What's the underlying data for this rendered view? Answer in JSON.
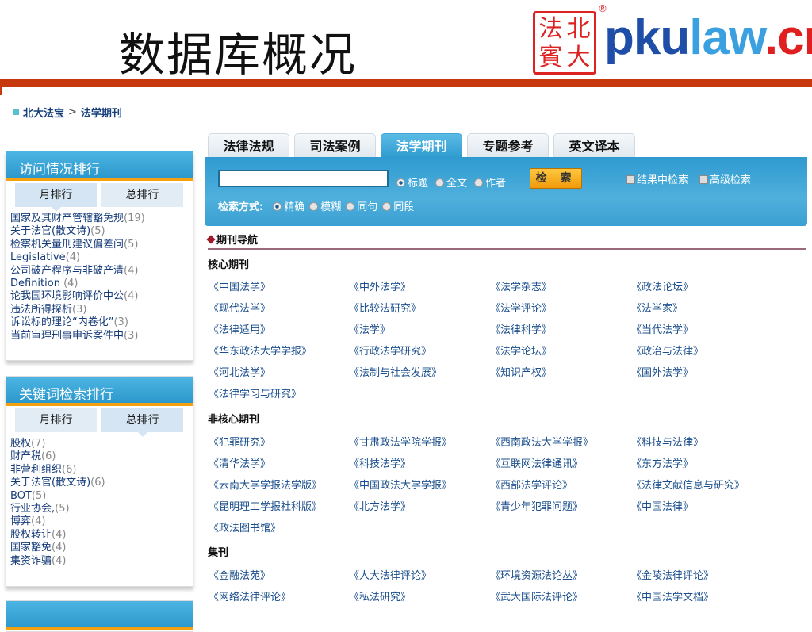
{
  "slide_title": "数据库概况",
  "logo": {
    "seal_chars": [
      "法",
      "北",
      "賓",
      "大"
    ],
    "text_parts": [
      "pku",
      "law",
      ".cn"
    ],
    "reg": "®"
  },
  "breadcrumb": {
    "home": "北大法宝",
    "sep": ">",
    "current": "法学期刊"
  },
  "visit_panel": {
    "title": "访问情况排行",
    "tabs": [
      "月排行",
      "总排行"
    ],
    "active_tab": 0,
    "items": [
      {
        "t": "国家及其财产管辖豁免规",
        "c": "(19)"
      },
      {
        "t": "关于法官(散文诗)",
        "c": "(5)"
      },
      {
        "t": "检察机关量刑建议偏差问",
        "c": "(5)"
      },
      {
        "t": "Legislative",
        "c": "(4)"
      },
      {
        "t": "公司破产程序与非破产清",
        "c": "(4)"
      },
      {
        "t": "Definition ",
        "c": "(4)"
      },
      {
        "t": "论我国环境影响评价中公",
        "c": "(4)"
      },
      {
        "t": "违法所得探析",
        "c": "(3)"
      },
      {
        "t": "诉讼标的理论“内卷化”",
        "c": "(3)"
      },
      {
        "t": "当前审理刑事申诉案件中",
        "c": "(3)"
      }
    ]
  },
  "keyword_panel": {
    "title": "关键词检索排行",
    "tabs": [
      "月排行",
      "总排行"
    ],
    "active_tab": 1,
    "items": [
      {
        "t": "股权",
        "c": "(7)"
      },
      {
        "t": "财产税",
        "c": "(6)"
      },
      {
        "t": "非营利组织",
        "c": "(6)"
      },
      {
        "t": "关于法官(散文诗)",
        "c": "(6)"
      },
      {
        "t": "BOT",
        "c": "(5)"
      },
      {
        "t": "行业协会,",
        "c": "(5)"
      },
      {
        "t": "博弈",
        "c": "(4)"
      },
      {
        "t": "股权转让",
        "c": "(4)"
      },
      {
        "t": "国家豁免",
        "c": "(4)"
      },
      {
        "t": "集资诈骗",
        "c": "(4)"
      }
    ]
  },
  "main_tabs": [
    "法律法规",
    "司法案例",
    "法学期刊",
    "专题参考",
    "英文译本"
  ],
  "active_main_tab": 2,
  "search": {
    "input_value": "",
    "scope_options": [
      "标题",
      "全文",
      "作者"
    ],
    "scope_selected": 0,
    "button": "检 索",
    "checkboxes": [
      "结果中检索",
      "高级检索"
    ],
    "mode_label": "检索方式:",
    "mode_options": [
      "精确",
      "模糊",
      "同句",
      "同段"
    ],
    "mode_selected": 0
  },
  "nav_title": "期刊导航",
  "sections": [
    {
      "title": "核心期刊",
      "items": [
        "《中国法学》",
        "《中外法学》",
        "《法学杂志》",
        "《政法论坛》",
        "《现代法学》",
        "《比较法研究》",
        "《法学评论》",
        "《法学家》",
        "《法律适用》",
        "《法学》",
        "《法律科学》",
        "《当代法学》",
        "《华东政法大学学报》",
        "《行政法学研究》",
        "《法学论坛》",
        "《政治与法律》",
        "《河北法学》",
        "《法制与社会发展》",
        "《知识产权》",
        "《国外法学》",
        "《法律学习与研究》"
      ]
    },
    {
      "title": "非核心期刊",
      "items": [
        "《犯罪研究》",
        "《甘肃政法学院学报》",
        "《西南政法大学学报》",
        "《科技与法律》",
        "《清华法学》",
        "《科技法学》",
        "《互联网法律通讯》",
        "《东方法学》",
        "《云南大学学报法学版》",
        "《中国政法大学学报》",
        "《西部法学评论》",
        "《法律文献信息与研究》",
        "《昆明理工学报社科版》",
        "《北方法学》",
        "《青少年犯罪问题》",
        "《中国法律》",
        "《政法图书馆》"
      ]
    },
    {
      "title": "集刊",
      "items": [
        "《金融法苑》",
        "《人大法律评论》",
        "《环境资源法论丛》",
        "《金陵法律评论》",
        "《网络法律评论》",
        "《私法研究》",
        "《武大国际法评论》",
        "《中国法学文档》"
      ]
    }
  ]
}
